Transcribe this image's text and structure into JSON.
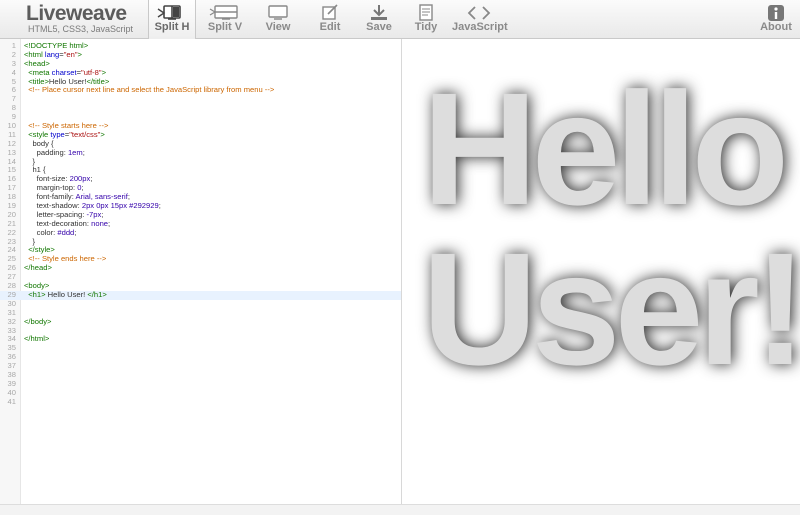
{
  "app": {
    "title": "Liveweave",
    "subtitle": "HTML5, CSS3, JavaScript"
  },
  "toolbar": {
    "buttons": [
      {
        "id": "split-h",
        "label": "Split H",
        "icon": "split-horizontal-icon",
        "active": true
      },
      {
        "id": "split-v",
        "label": "Split V",
        "icon": "split-vertical-icon",
        "active": false
      },
      {
        "id": "view",
        "label": "View",
        "icon": "monitor-icon",
        "active": false
      },
      {
        "id": "edit",
        "label": "Edit",
        "icon": "edit-icon",
        "active": false
      },
      {
        "id": "save",
        "label": "Save",
        "icon": "download-icon",
        "active": false
      },
      {
        "id": "tidy",
        "label": "Tidy",
        "icon": "document-icon",
        "active": false
      },
      {
        "id": "javascript",
        "label": "JavaScript",
        "icon": "code-brackets-icon",
        "active": false
      },
      {
        "id": "about",
        "label": "About",
        "icon": "info-icon",
        "active": false
      }
    ]
  },
  "editor": {
    "highlighted_line": 29,
    "lines": [
      [
        [
          "t-tag",
          "<!DOCTYPE html>"
        ]
      ],
      [
        [
          "t-tag",
          "<html "
        ],
        [
          "t-attr",
          "lang"
        ],
        [
          "",
          "="
        ],
        [
          "t-str",
          "\"en\""
        ],
        [
          "t-tag",
          ">"
        ]
      ],
      [
        [
          "t-tag",
          "<head>"
        ]
      ],
      [
        [
          "",
          "  "
        ],
        [
          "t-tag",
          "<meta "
        ],
        [
          "t-attr",
          "charset"
        ],
        [
          "",
          "="
        ],
        [
          "t-str",
          "\"utf-8\""
        ],
        [
          "t-tag",
          ">"
        ]
      ],
      [
        [
          "",
          "  "
        ],
        [
          "t-tag",
          "<title>"
        ],
        [
          "",
          "Hello User!"
        ],
        [
          "t-tag",
          "</title>"
        ]
      ],
      [
        [
          "",
          "  "
        ],
        [
          "t-com",
          "<!-- Place cursor next line and select the JavaScript library from menu -->"
        ]
      ],
      [],
      [],
      [],
      [
        [
          "",
          "  "
        ],
        [
          "t-com",
          "<!-- Style starts here -->"
        ]
      ],
      [
        [
          "",
          "  "
        ],
        [
          "t-tag",
          "<style "
        ],
        [
          "t-attr",
          "type"
        ],
        [
          "",
          "="
        ],
        [
          "t-str",
          "\"text/css\""
        ],
        [
          "t-tag",
          ">"
        ]
      ],
      [
        [
          "",
          "    body {"
        ]
      ],
      [
        [
          "",
          "      "
        ],
        [
          "t-prop",
          "padding"
        ],
        [
          "",
          ": "
        ],
        [
          "t-val",
          "1em"
        ],
        [
          "",
          ";"
        ]
      ],
      [
        [
          "",
          "    }"
        ]
      ],
      [
        [
          "",
          "    h1 {"
        ]
      ],
      [
        [
          "",
          "      "
        ],
        [
          "t-prop",
          "font-size"
        ],
        [
          "",
          ": "
        ],
        [
          "t-val",
          "200px"
        ],
        [
          "",
          ";"
        ]
      ],
      [
        [
          "",
          "      "
        ],
        [
          "t-prop",
          "margin-top"
        ],
        [
          "",
          ": "
        ],
        [
          "t-val",
          "0"
        ],
        [
          "",
          ";"
        ]
      ],
      [
        [
          "",
          "      "
        ],
        [
          "t-prop",
          "font-family"
        ],
        [
          "",
          ": "
        ],
        [
          "t-val",
          "Arial, sans-serif"
        ],
        [
          "",
          ";"
        ]
      ],
      [
        [
          "",
          "      "
        ],
        [
          "t-prop",
          "text-shadow"
        ],
        [
          "",
          ": "
        ],
        [
          "t-val",
          "2px 0px 15px #292929"
        ],
        [
          "",
          ";"
        ]
      ],
      [
        [
          "",
          "      "
        ],
        [
          "t-prop",
          "letter-spacing"
        ],
        [
          "",
          ": "
        ],
        [
          "t-val",
          "-7px"
        ],
        [
          "",
          ";"
        ]
      ],
      [
        [
          "",
          "      "
        ],
        [
          "t-prop",
          "text-decoration"
        ],
        [
          "",
          ": "
        ],
        [
          "t-val",
          "none"
        ],
        [
          "",
          ";"
        ]
      ],
      [
        [
          "",
          "      "
        ],
        [
          "t-prop",
          "color"
        ],
        [
          "",
          ": "
        ],
        [
          "t-val",
          "#ddd"
        ],
        [
          "",
          ";"
        ]
      ],
      [
        [
          "",
          "    }"
        ]
      ],
      [
        [
          "",
          "  "
        ],
        [
          "t-tag",
          "</style>"
        ]
      ],
      [
        [
          "",
          "  "
        ],
        [
          "t-com",
          "<!-- Style ends here -->"
        ]
      ],
      [
        [
          "t-tag",
          "</head>"
        ]
      ],
      [],
      [
        [
          "t-tag",
          "<body>"
        ]
      ],
      [
        [
          "",
          "  "
        ],
        [
          "t-tag",
          "<h1>"
        ],
        [
          "",
          " Hello User! "
        ],
        [
          "t-tag",
          "</h1>"
        ]
      ],
      [],
      [],
      [
        [
          "t-tag",
          "</body>"
        ]
      ],
      [],
      [
        [
          "t-tag",
          "</html>"
        ]
      ],
      [],
      [],
      [],
      [],
      [],
      [],
      []
    ]
  },
  "preview": {
    "heading": "Hello User!"
  }
}
